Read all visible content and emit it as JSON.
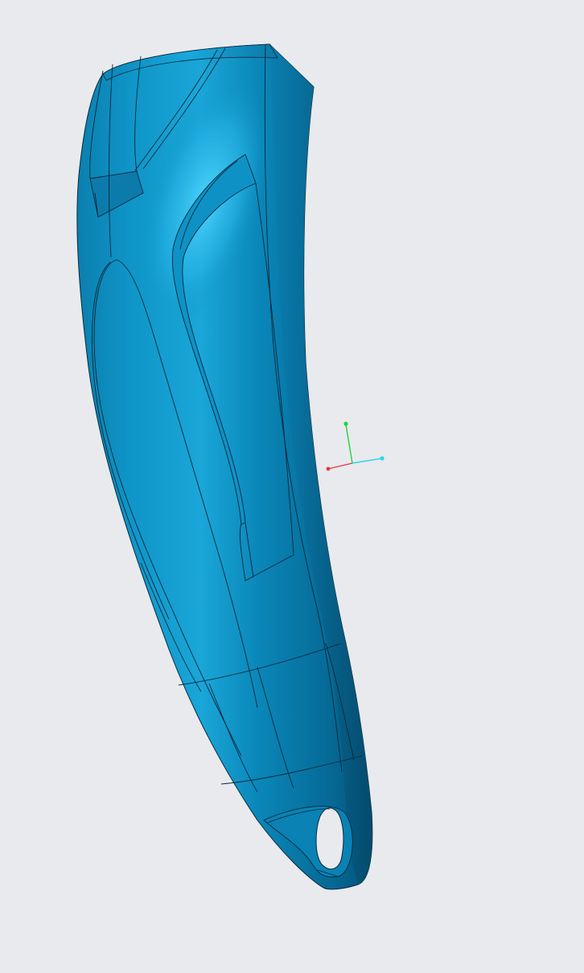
{
  "viewport": {
    "background_color": "#e8eaee"
  },
  "model": {
    "name_icon": "cad-part-shell",
    "surface_color": "#0a8ec0",
    "highlight_color": "#48cfff",
    "shadow_color": "#045a80",
    "edge_color": "#06283a"
  },
  "triad": {
    "icon": "coordinate-triad-icon",
    "x_axis_color": "#e8383b",
    "y_axis_color": "#1fd43a",
    "z_axis_color": "#2ad7e6"
  }
}
